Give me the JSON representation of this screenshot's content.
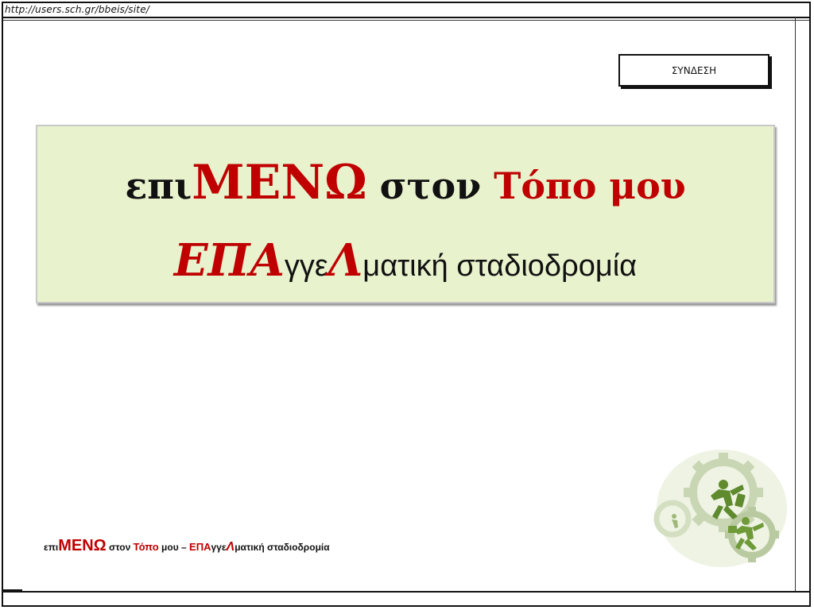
{
  "browser": {
    "url": "http://users.sch.gr/bbeis/site/"
  },
  "header": {
    "login_label": "ΣΥΝΔΕΣΗ"
  },
  "banner": {
    "line1": {
      "part1": "επι",
      "part2": "ΜΕΝΩ",
      "part3": " στον ",
      "part4": "Τόπο μου"
    },
    "line2": {
      "part1": "ΕΠΑ",
      "part2": "γγε",
      "part3": "Λ",
      "part4": "ματική σταδιοδρομία"
    },
    "background_color": "#e8f2cd",
    "accent_color": "#c00000"
  },
  "footer": {
    "logo": {
      "part1": "επι",
      "part2": "ΜΕΝΩ",
      "part3": " στον ",
      "part4": "Τόπο",
      "part5": " μου – ",
      "part6": "ΕΠΑ",
      "part7": "γγε",
      "part8": "Λ",
      "part9": "ματική  σταδιοδρομία"
    }
  },
  "decoration": {
    "icon": "gears-with-running-figures-icon"
  }
}
